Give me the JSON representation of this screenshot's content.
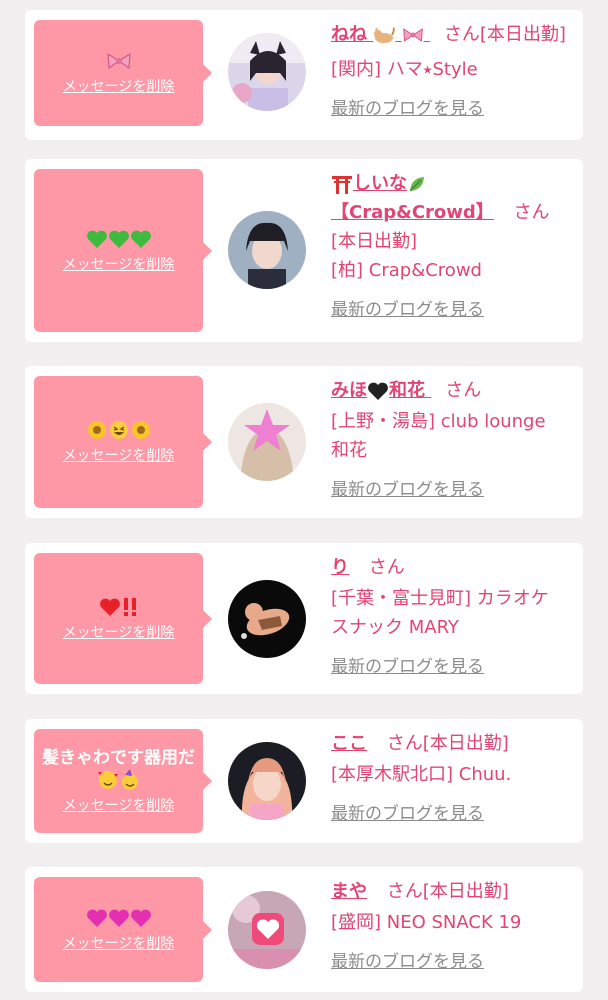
{
  "san_label": "さん",
  "delete_label": "メッセージを削除",
  "blog_label": "最新のブログを見る",
  "colors": {
    "bubble": "#fe98a6",
    "name": "#e24474",
    "link": "#8c8c8c"
  },
  "cards": [
    {
      "name": "ねね",
      "name_icons": [
        "cat-emoji",
        "bow-emoji"
      ],
      "shift": "[本日出勤]",
      "area_shop": "[関内] ハマ⭑Style",
      "message_icons": [
        "bow-emoji"
      ]
    },
    {
      "name_prefix_icon": "torii-emoji",
      "name": "しいな",
      "name_icon": "leaf-emoji",
      "name2": "【Crap&Crowd】",
      "shift": "[本日出勤]",
      "area_shop": "[柏] Crap&Crowd",
      "message_icons": [
        "green-heart-emoji",
        "green-heart-emoji",
        "green-heart-emoji"
      ]
    },
    {
      "name": "みほ",
      "name_icon": "black-heart-emoji",
      "name_after": "和花",
      "area_shop_1": "[上野・湯島] club lounge",
      "area_shop_2": "和花",
      "message_icons": [
        "sunflower-emoji",
        "laughing-face-emoji",
        "sunflower-emoji"
      ]
    },
    {
      "name": "り",
      "area_shop_1": "[千葉・富士見町] カラオケ",
      "area_shop_2": "スナック MARY",
      "message_icons": [
        "red-heart-emoji",
        "double-exclamation-emoji"
      ]
    },
    {
      "name": "ここ",
      "shift": "[本日出勤]",
      "area_shop": "[本厚木駅北口] Chuu.",
      "message_text": "髪きゃわです器用だ",
      "message_icons": [
        "smiling-hearts-emoji",
        "party-face-emoji"
      ]
    },
    {
      "name": "まや",
      "shift": "[本日出勤]",
      "area_shop": "[盛岡] NEO SNACK 19",
      "message_icons": [
        "pink-heart-emoji",
        "pink-heart-emoji",
        "pink-heart-emoji"
      ]
    }
  ]
}
